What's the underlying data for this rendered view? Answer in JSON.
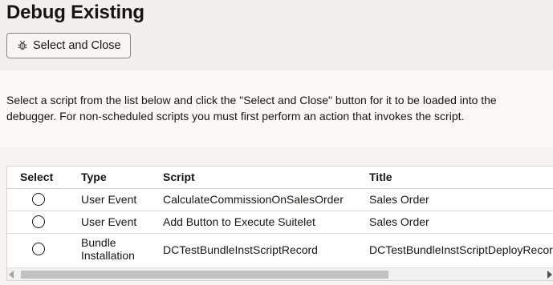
{
  "page": {
    "title": "Debug Existing"
  },
  "toolbar": {
    "select_close_label": "Select and Close",
    "select_close_icon": "bug-icon"
  },
  "description": "Select a script from the list below and click the \"Select and Close\" button for it to be loaded into the debugger. For non-scheduled scripts you must first perform an action that invokes the script.",
  "table": {
    "headers": {
      "select": "Select",
      "type": "Type",
      "script": "Script",
      "title": "Title"
    },
    "rows": [
      {
        "selected": false,
        "type": "User Event",
        "script": "CalculateCommissionOnSalesOrder",
        "title": "Sales Order"
      },
      {
        "selected": false,
        "type": "User Event",
        "script": "Add Button to Execute Suitelet",
        "title": "Sales Order"
      },
      {
        "selected": false,
        "type_line1": "Bundle",
        "type_line2": "Installation",
        "script": "DCTestBundleInstScriptRecord",
        "title": "DCTestBundleInstScriptDeployRecord"
      }
    ]
  }
}
